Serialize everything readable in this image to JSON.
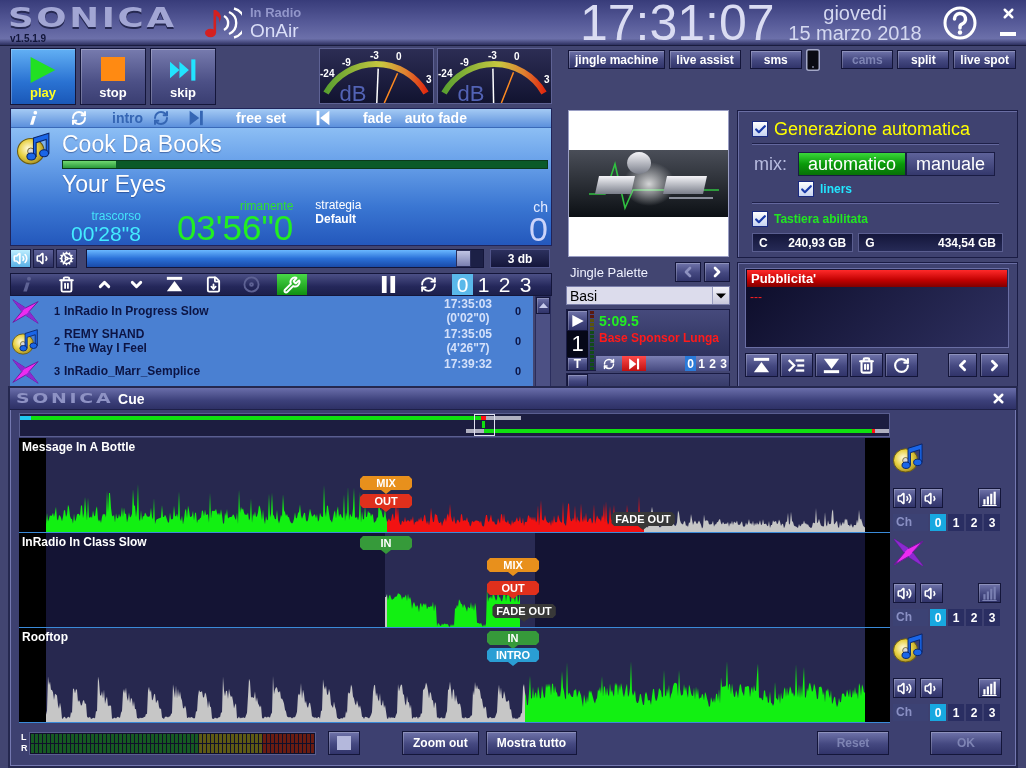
{
  "header": {
    "logo": "SONICA",
    "version": "v1.5.1.9",
    "station": "In Radio",
    "status": "OnAir",
    "clock": "17:31:07",
    "weekday": "giovedi",
    "date": "15 marzo 2018"
  },
  "transport": [
    {
      "kind": "play",
      "label": "play",
      "selected": true
    },
    {
      "kind": "stop",
      "label": "stop",
      "selected": false
    },
    {
      "kind": "skip",
      "label": "skip",
      "selected": false
    }
  ],
  "vu_meters": [
    {
      "scale": [
        "-24",
        "-9",
        "-3",
        "0",
        "3"
      ],
      "unit": "dB",
      "needles": [
        {
          "kind": "average",
          "level": 0.52
        },
        {
          "kind": "peak",
          "level": 0.7
        }
      ]
    },
    {
      "scale": [
        "-24",
        "-9",
        "-3",
        "0",
        "3"
      ],
      "unit": "dB",
      "needles": [
        {
          "kind": "average",
          "level": 0.49
        },
        {
          "kind": "peak",
          "level": 0.68
        }
      ]
    }
  ],
  "player": {
    "toolbar": [
      {
        "kind": "info",
        "disabled": false
      },
      {
        "kind": "loop",
        "disabled": false
      },
      {
        "kind": "text",
        "label": "intro",
        "disabled": true
      },
      {
        "kind": "loop",
        "disabled": true
      },
      {
        "kind": "skip-end",
        "disabled": true
      },
      {
        "kind": "text",
        "label": "free set",
        "disabled": false
      },
      {
        "kind": "skip-start",
        "disabled": false
      },
      {
        "kind": "text",
        "label": "fade",
        "disabled": false
      },
      {
        "kind": "text",
        "label": "auto fade",
        "disabled": false
      }
    ],
    "artist": "Cook Da Books",
    "level": 0.11,
    "title": "Your Eyes",
    "elapsed_label": "trascorso",
    "elapsed": "00'28\"8",
    "remaining_label": "rimanente",
    "remaining": "03'56\"0",
    "strategy_label": "strategia",
    "strategy": "Default",
    "channel_label": "ch",
    "channel": "0"
  },
  "volume": {
    "buttons": [
      {
        "kind": "loud",
        "selected": true
      },
      {
        "kind": "quiet",
        "selected": false
      },
      {
        "kind": "settings",
        "selected": false
      }
    ],
    "level": 0.97,
    "reading": "3 db"
  },
  "playlist": {
    "toolbar": [
      {
        "kind": "info",
        "disabled": true,
        "active": false
      },
      {
        "kind": "trash",
        "disabled": false,
        "active": false
      },
      {
        "kind": "up",
        "disabled": false,
        "active": false
      },
      {
        "kind": "down",
        "disabled": false,
        "active": false
      },
      {
        "kind": "top",
        "disabled": false,
        "active": false
      },
      {
        "kind": "import",
        "disabled": false,
        "active": false
      },
      {
        "kind": "disc",
        "disabled": true,
        "active": false
      },
      {
        "kind": "tools",
        "disabled": false,
        "active": true
      },
      {
        "kind": "pause",
        "disabled": false,
        "active": false
      },
      {
        "kind": "loop",
        "disabled": false,
        "active": false
      }
    ],
    "channels": [
      {
        "label": "0",
        "selected": true
      },
      {
        "label": "1",
        "selected": false
      },
      {
        "label": "2",
        "selected": false
      },
      {
        "label": "3",
        "selected": false
      }
    ],
    "rows": [
      {
        "kind": "jingle",
        "number": "1",
        "lines": [
          "InRadio In Progress Slow"
        ],
        "time": "17:35:03",
        "duration": "(0'02\"0)",
        "channel": "0"
      },
      {
        "kind": "song",
        "number": "2",
        "lines": [
          "REMY SHAND",
          "The Way I Feel"
        ],
        "time": "17:35:05",
        "duration": "(4'26\"7)",
        "channel": "0"
      },
      {
        "kind": "jingle",
        "number": "3",
        "lines": [
          "InRadio_Marr_Semplice"
        ],
        "time": "17:39:32",
        "channel": "0"
      }
    ]
  },
  "top_buttons": [
    [
      {
        "kind": "button",
        "label": "jingle machine",
        "disabled": false
      },
      {
        "kind": "button",
        "label": "live assist",
        "disabled": false
      }
    ],
    [
      {
        "kind": "button",
        "label": "sms",
        "disabled": false
      },
      {
        "kind": "phone"
      }
    ],
    [
      {
        "kind": "button",
        "label": "cams",
        "disabled": true
      },
      {
        "kind": "button",
        "label": "split",
        "disabled": false
      },
      {
        "kind": "button",
        "label": "live spot",
        "disabled": false
      }
    ]
  ],
  "jingle_palette": {
    "title": "Jingle Palette",
    "nav": [
      {
        "kind": "prev",
        "disabled": true
      },
      {
        "kind": "next",
        "disabled": false
      }
    ],
    "palette": "Basi",
    "carts": [
      {
        "number": "1",
        "hotkey": "T",
        "time": "5:09.5",
        "name": "Base Sponsor Lunga",
        "controls": [
          {
            "kind": "loop",
            "active": false
          },
          {
            "kind": "skip-end",
            "active": true
          }
        ],
        "channels": [
          {
            "label": "0",
            "selected": true
          },
          {
            "label": "1",
            "selected": false
          },
          {
            "label": "2",
            "selected": false
          },
          {
            "label": "3",
            "selected": false
          }
        ]
      }
    ]
  },
  "generation": {
    "auto": {
      "label": "Generazione automatica",
      "checked": true
    },
    "mix_label": "mix:",
    "mix_options": [
      {
        "label": "automatico",
        "selected": true
      },
      {
        "label": "manuale",
        "selected": false
      }
    ],
    "liners": {
      "label": "liners",
      "checked": true
    },
    "keyboard": {
      "label": "Tastiera abilitata",
      "checked": true
    },
    "drives": [
      {
        "letter": "C",
        "free": "240,93 GB"
      },
      {
        "letter": "G",
        "free": "434,54 GB"
      }
    ]
  },
  "ads": {
    "title": "Pubblicita'",
    "items": [
      "---"
    ],
    "buttons": [
      {
        "kind": "top"
      },
      {
        "kind": "insert"
      },
      {
        "kind": "bottom"
      },
      {
        "kind": "trash"
      },
      {
        "kind": "reload"
      }
    ],
    "nav": [
      {
        "kind": "prev"
      },
      {
        "kind": "next"
      }
    ]
  },
  "cue": {
    "logo": "SONICA",
    "title": "Cue",
    "tracks": [
      {
        "kind": "song",
        "title": "Message In A Bottle",
        "markers": [
          {
            "label": "MIX",
            "color": "#e8901c"
          },
          {
            "label": "OUT",
            "color": "#e0301c"
          },
          {
            "label": "FADE OUT",
            "color": "#383838"
          }
        ],
        "controls": [
          {
            "kind": "loud",
            "disabled": false
          },
          {
            "kind": "quiet",
            "disabled": false
          },
          {
            "kind": "bars",
            "disabled": false
          }
        ],
        "channel_label": "Ch",
        "channels": [
          {
            "label": "0",
            "selected": true
          },
          {
            "label": "1",
            "selected": false
          },
          {
            "label": "2",
            "selected": false
          },
          {
            "label": "3",
            "selected": false
          }
        ]
      },
      {
        "kind": "jingle",
        "title": "InRadio In Class Slow",
        "markers": [
          {
            "label": "IN",
            "color": "#369a3a"
          },
          {
            "label": "MIX",
            "color": "#e8901c"
          },
          {
            "label": "OUT",
            "color": "#e0301c"
          },
          {
            "label": "FADE OUT",
            "color": "#383838"
          }
        ],
        "controls": [
          {
            "kind": "loud",
            "disabled": false
          },
          {
            "kind": "quiet",
            "disabled": false
          },
          {
            "kind": "bars",
            "disabled": true
          }
        ],
        "channel_label": "Ch",
        "channels": [
          {
            "label": "0",
            "selected": true
          },
          {
            "label": "1",
            "selected": false
          },
          {
            "label": "2",
            "selected": false
          },
          {
            "label": "3",
            "selected": false
          }
        ]
      },
      {
        "kind": "song",
        "title": "Rooftop",
        "markers": [
          {
            "label": "IN",
            "color": "#369a3a"
          },
          {
            "label": "INTRO",
            "color": "#2a9ed4"
          }
        ],
        "controls": [
          {
            "kind": "loud",
            "disabled": false
          },
          {
            "kind": "quiet",
            "disabled": false
          },
          {
            "kind": "bars",
            "disabled": false
          }
        ],
        "channel_label": "Ch",
        "channels": [
          {
            "label": "0",
            "selected": true
          },
          {
            "label": "1",
            "selected": false
          },
          {
            "label": "2",
            "selected": false
          },
          {
            "label": "3",
            "selected": false
          }
        ]
      }
    ],
    "meter_labels": [
      "L",
      "R"
    ],
    "left_buttons": [
      {
        "label": "Zoom out",
        "disabled": false
      },
      {
        "label": "Mostra tutto",
        "disabled": false
      }
    ],
    "right_buttons": [
      {
        "label": "Reset",
        "disabled": true
      },
      {
        "label": "OK",
        "disabled": true
      }
    ]
  }
}
